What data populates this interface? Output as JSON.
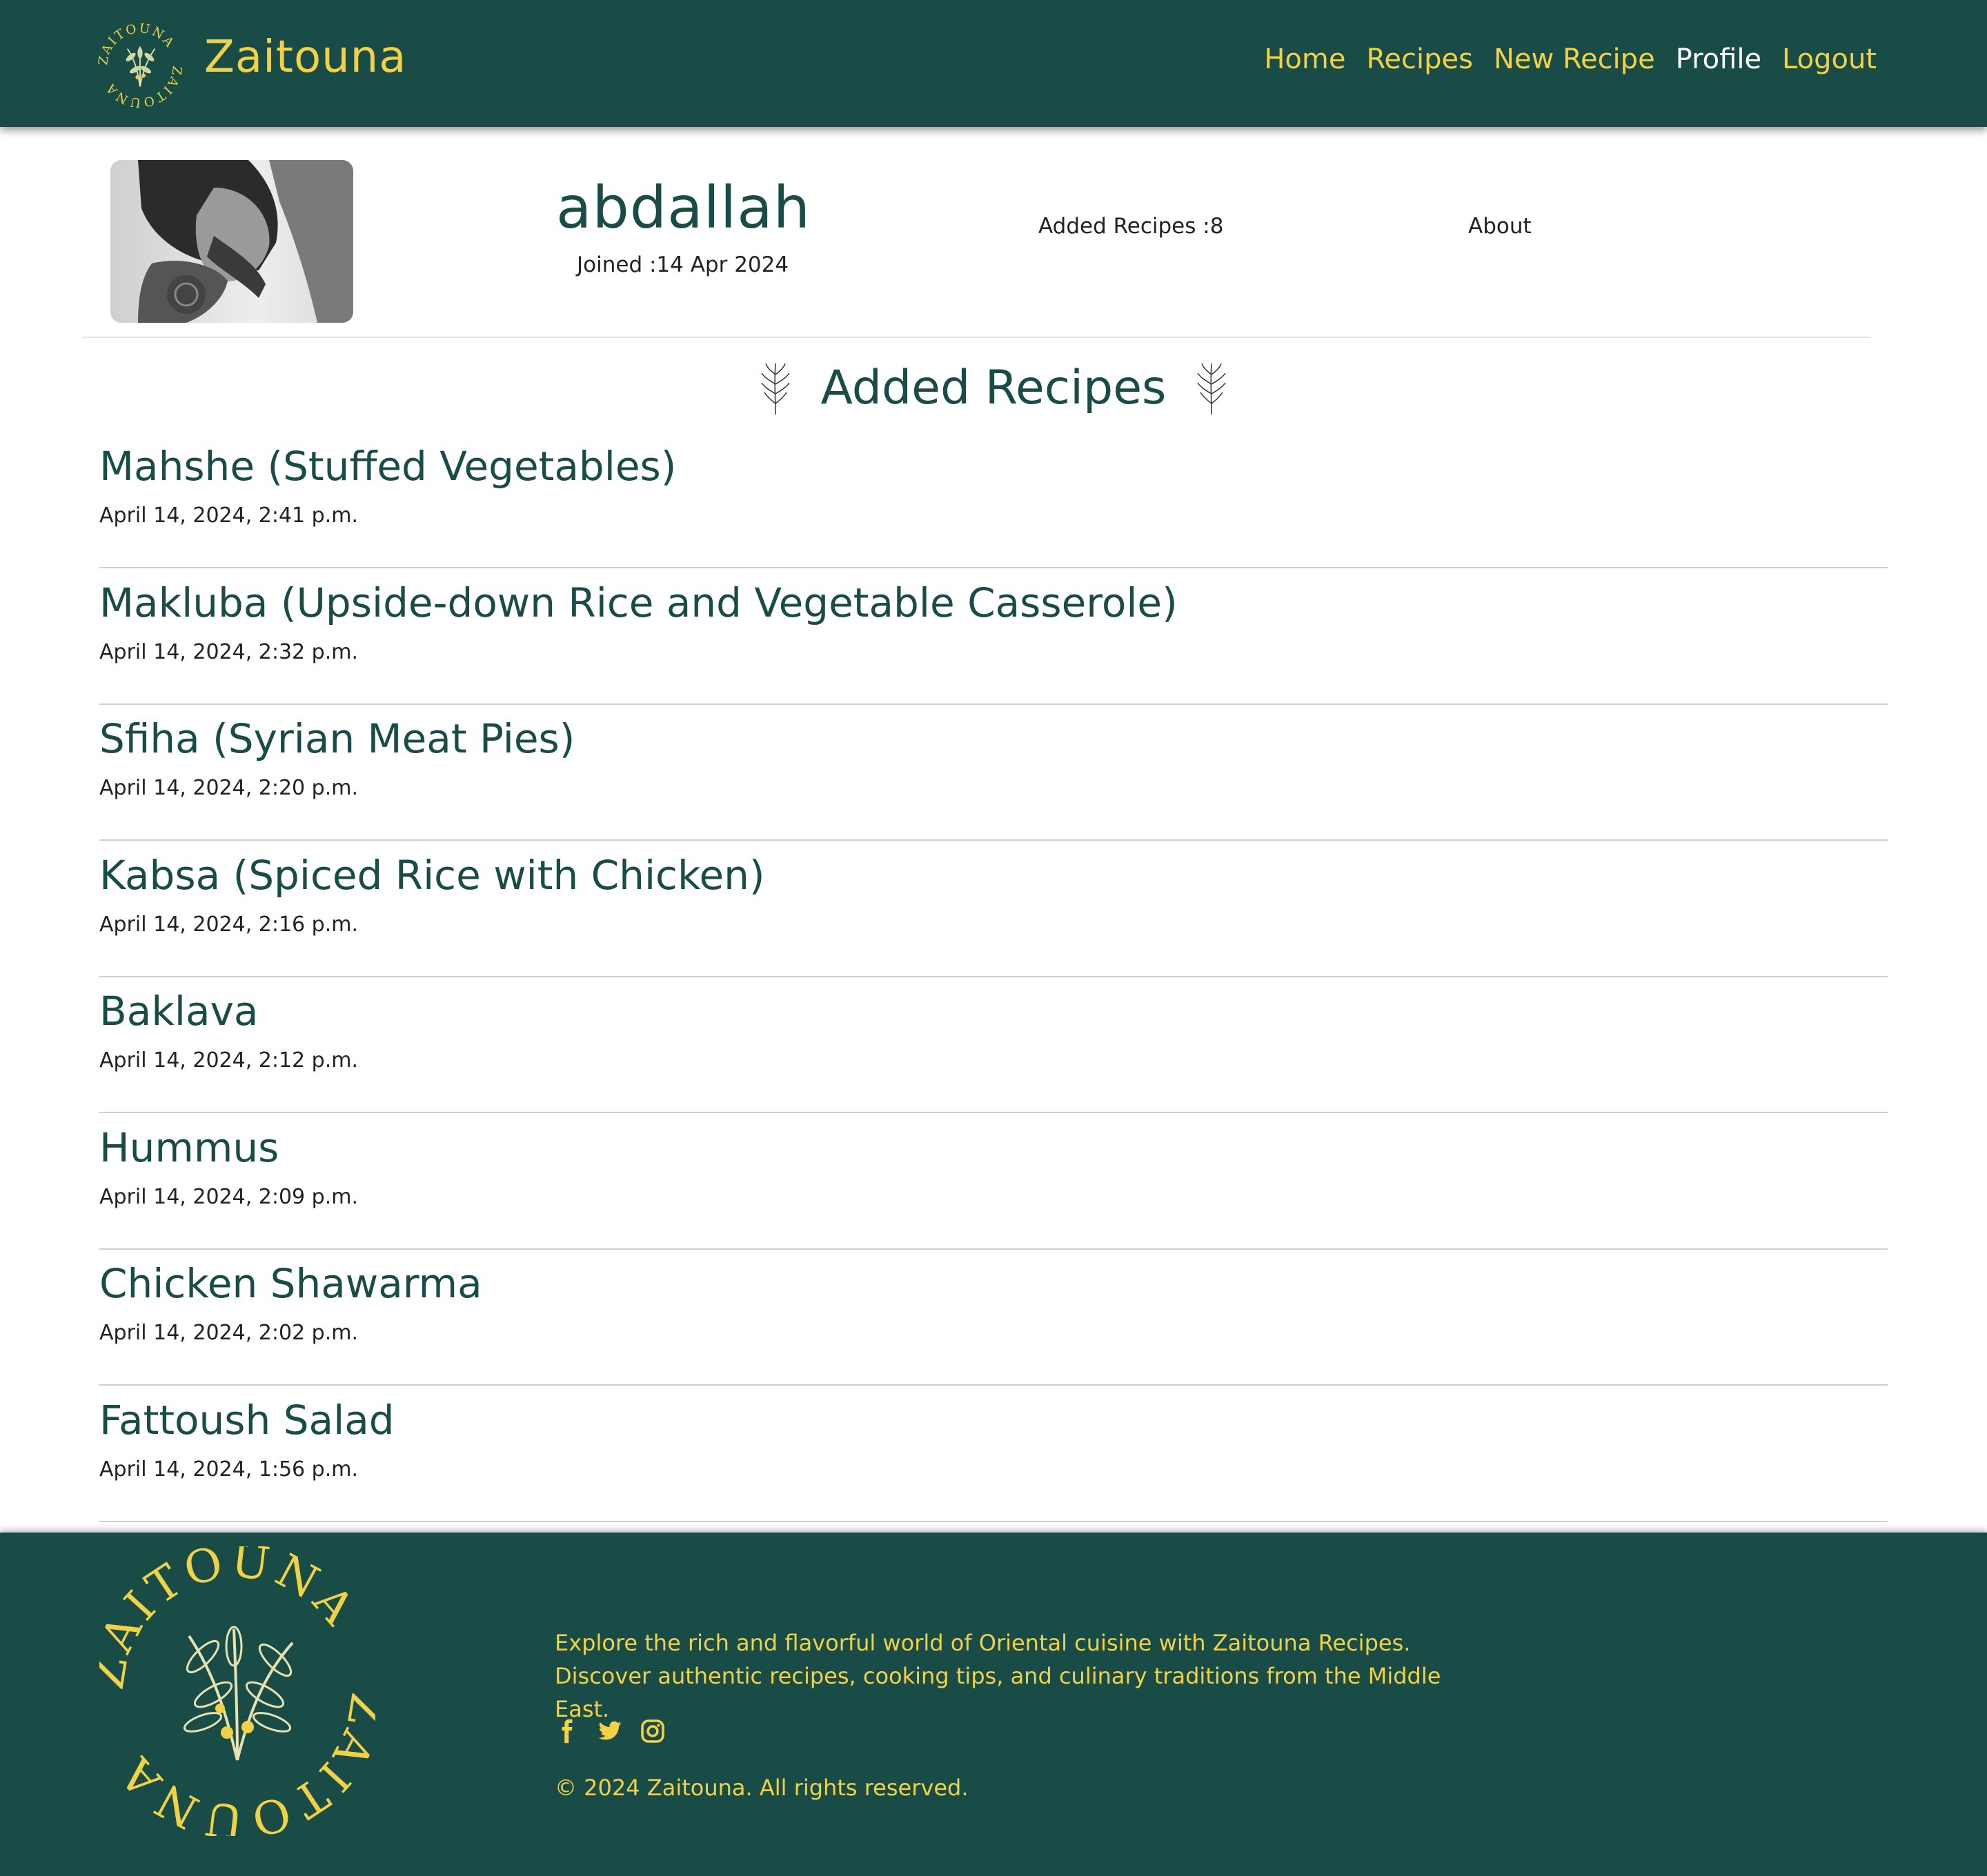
{
  "colors": {
    "primary": "#1a4c47",
    "accent": "#f1d246",
    "white": "#ffffff"
  },
  "navbar": {
    "brand": "Zaitouna",
    "logo_text": "ZAITOUNA",
    "links": [
      "Home",
      "Recipes",
      "New Recipe",
      "Profile",
      "Logout"
    ],
    "active": "Profile"
  },
  "profile": {
    "username": "abdallah",
    "joined": "Joined :14 Apr 2024",
    "added_recipes": "Added Recipes :8",
    "about": "About"
  },
  "section_title": "Added Recipes",
  "recipes": [
    {
      "title": "Mahshe (Stuffed Vegetables)",
      "date": "April 14, 2024, 2:41 p.m."
    },
    {
      "title": "Makluba (Upside-down Rice and Vegetable Casserole)",
      "date": "April 14, 2024, 2:32 p.m."
    },
    {
      "title": "Sfiha (Syrian Meat Pies)",
      "date": "April 14, 2024, 2:20 p.m."
    },
    {
      "title": "Kabsa (Spiced Rice with Chicken)",
      "date": "April 14, 2024, 2:16 p.m."
    },
    {
      "title": "Baklava",
      "date": "April 14, 2024, 2:12 p.m."
    },
    {
      "title": "Hummus",
      "date": "April 14, 2024, 2:09 p.m."
    },
    {
      "title": "Chicken Shawarma",
      "date": "April 14, 2024, 2:02 p.m."
    },
    {
      "title": "Fattoush Salad",
      "date": "April 14, 2024, 1:56 p.m."
    }
  ],
  "footer": {
    "logo_text": "ZAITOUNA",
    "description": "Explore the rich and flavorful world of Oriental cuisine with Zaitouna Recipes. Discover authentic recipes, cooking tips, and culinary traditions from the Middle East.",
    "social_icons": [
      "facebook-icon",
      "twitter-icon",
      "instagram-icon"
    ],
    "copyright": "© 2024 Zaitouna. All rights reserved."
  }
}
